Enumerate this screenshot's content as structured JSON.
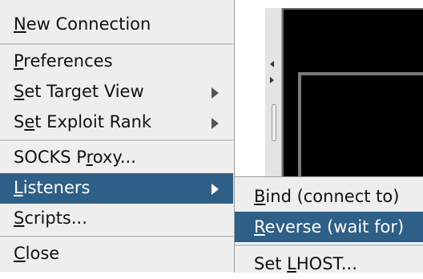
{
  "menu": {
    "items": [
      {
        "pre": "",
        "mn": "N",
        "post": "ew Connection"
      },
      {
        "pre": "",
        "mn": "P",
        "post": "references"
      },
      {
        "pre": "",
        "mn": "S",
        "post": "et Target View"
      },
      {
        "pre": "S",
        "mn": "e",
        "post": "t Exploit Rank"
      },
      {
        "pre": "SOCKS P",
        "mn": "r",
        "post": "oxy..."
      },
      {
        "pre": "",
        "mn": "L",
        "post": "isteners"
      },
      {
        "pre": "",
        "mn": "S",
        "post": "cripts..."
      },
      {
        "pre": "",
        "mn": "C",
        "post": "lose"
      }
    ]
  },
  "submenu": {
    "items": [
      {
        "pre": "",
        "mn": "B",
        "post": "ind (connect to)"
      },
      {
        "pre": "",
        "mn": "R",
        "post": "everse (wait for)"
      },
      {
        "pre": "Set ",
        "mn": "L",
        "post": "HOST..."
      }
    ]
  },
  "colors": {
    "selection": "#2e5f86",
    "menu_background": "#eeeeee",
    "console_background": "#000000"
  },
  "icons": {
    "submenu_arrow": "triangle-right-icon",
    "divider_left": "arrow-left-icon",
    "divider_right": "arrow-right-icon"
  }
}
